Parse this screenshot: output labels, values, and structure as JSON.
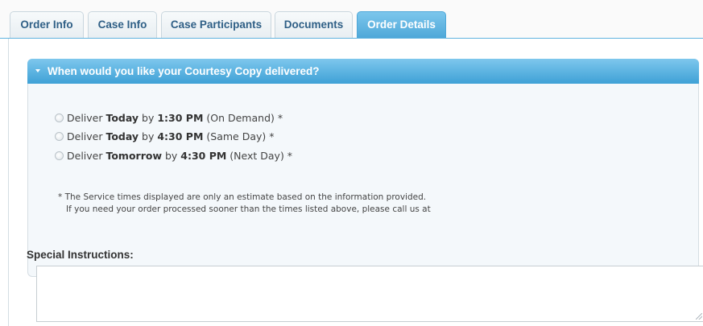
{
  "tabs": [
    {
      "label": "Order Info",
      "active": false
    },
    {
      "label": "Case Info",
      "active": false
    },
    {
      "label": "Case Participants",
      "active": false
    },
    {
      "label": "Documents",
      "active": false
    },
    {
      "label": "Order Details",
      "active": true
    }
  ],
  "delivery": {
    "title": "When would you like your Courtesy Copy delivered?",
    "options": [
      {
        "pre": "Deliver ",
        "day": "Today",
        "by": " by ",
        "time": "1:30 PM",
        "suffix": " (On Demand) *",
        "selected": false
      },
      {
        "pre": "Deliver ",
        "day": "Today",
        "by": " by ",
        "time": "4:30 PM",
        "suffix": " (Same Day) *",
        "selected": false
      },
      {
        "pre": "Deliver ",
        "day": "Tomorrow",
        "by": " by ",
        "time": "4:30 PM",
        "suffix": " (Next Day) *",
        "selected": false
      }
    ],
    "note_line1": "* The Service times displayed are only an estimate based on the information provided.",
    "note_line2": "If you need your order processed sooner than the times listed above, please call us at"
  },
  "special_instructions": {
    "label": "Special Instructions:",
    "value": ""
  }
}
